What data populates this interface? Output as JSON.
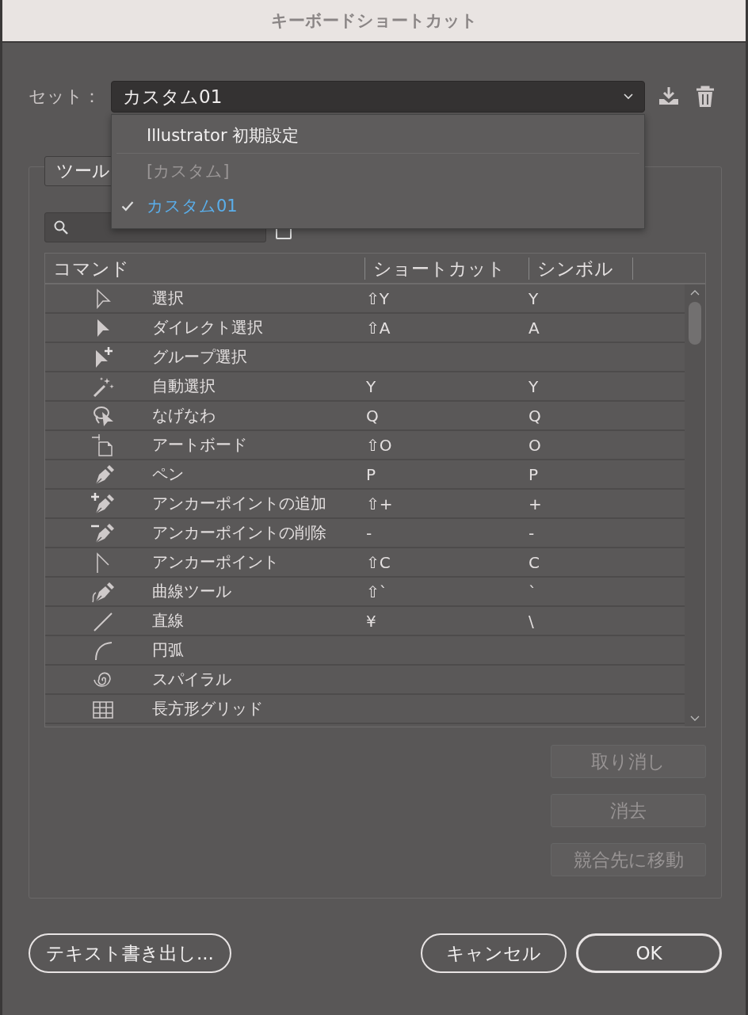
{
  "window": {
    "title": "キーボードショートカット"
  },
  "set": {
    "label": "セット：",
    "value": "カスタム01",
    "menu": [
      {
        "kind": "item",
        "label": "Illustrator 初期設定",
        "selected": false,
        "disabled": false
      },
      {
        "kind": "separator"
      },
      {
        "kind": "item",
        "label": "[カスタム]",
        "selected": false,
        "disabled": true
      },
      {
        "kind": "item",
        "label": "カスタム01",
        "selected": true,
        "disabled": false
      }
    ]
  },
  "category": {
    "value": "ツール"
  },
  "case_checkbox": {
    "checked": false
  },
  "table": {
    "columns": [
      "コマンド",
      "ショートカット",
      "シンボル"
    ],
    "rows": [
      {
        "command": "選択",
        "shortcut": "⇧Y",
        "symbol": "Y"
      },
      {
        "command": "ダイレクト選択",
        "shortcut": "⇧A",
        "symbol": "A"
      },
      {
        "command": "グループ選択",
        "shortcut": "",
        "symbol": ""
      },
      {
        "command": "自動選択",
        "shortcut": "Y",
        "symbol": "Y"
      },
      {
        "command": "なげなわ",
        "shortcut": "Q",
        "symbol": "Q"
      },
      {
        "command": "アートボード",
        "shortcut": "⇧O",
        "symbol": "O"
      },
      {
        "command": "ペン",
        "shortcut": "P",
        "symbol": "P"
      },
      {
        "command": "アンカーポイントの追加",
        "shortcut": "⇧+",
        "symbol": "+"
      },
      {
        "command": "アンカーポイントの削除",
        "shortcut": "-",
        "symbol": "-"
      },
      {
        "command": "アンカーポイント",
        "shortcut": "⇧C",
        "symbol": "C"
      },
      {
        "command": "曲線ツール",
        "shortcut": "⇧`",
        "symbol": "`"
      },
      {
        "command": "直線",
        "shortcut": "¥",
        "symbol": "\\"
      },
      {
        "command": "円弧",
        "shortcut": "",
        "symbol": ""
      },
      {
        "command": "スパイラル",
        "shortcut": "",
        "symbol": ""
      },
      {
        "command": "長方形グリッド",
        "shortcut": "",
        "symbol": ""
      }
    ]
  },
  "side_buttons": [
    {
      "label": "取り消し",
      "disabled": true
    },
    {
      "label": "消去",
      "disabled": true
    },
    {
      "label": "競合先に移動",
      "disabled": true
    }
  ],
  "footer": {
    "export": "テキスト書き出し...",
    "cancel": "キャンセル",
    "ok": "OK"
  }
}
